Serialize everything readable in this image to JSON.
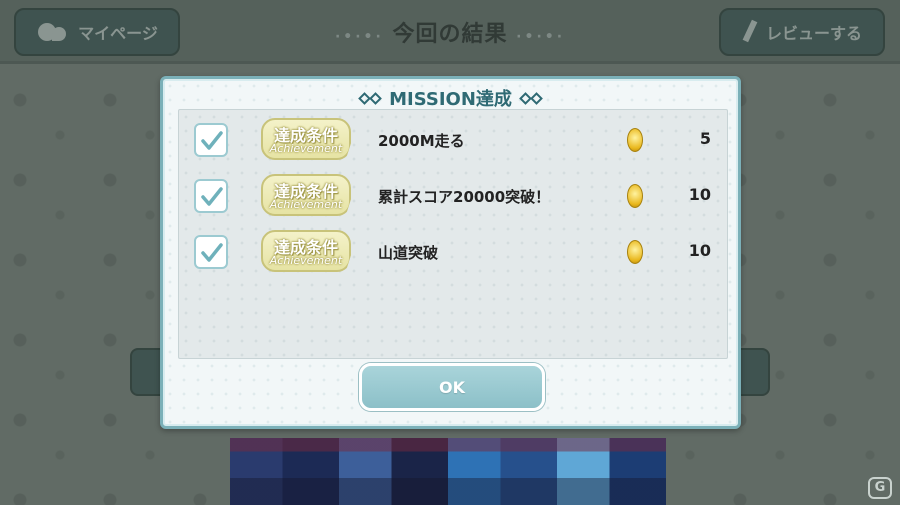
{
  "topbar": {
    "mypage_label": "マイページ",
    "title": "今回の結果",
    "review_label": "レビューする"
  },
  "modal": {
    "title": "MISSION達成",
    "badge_main": "達成条件",
    "badge_sub": "Achievement",
    "missions": [
      {
        "text": "2000M走る",
        "reward": "5",
        "checked": true
      },
      {
        "text": "累計スコア20000突破！",
        "reward": "10",
        "checked": true
      },
      {
        "text": "山道突破",
        "reward": "10",
        "checked": true
      }
    ],
    "ok_label": "OK"
  },
  "watermark": "G",
  "colors": {
    "accent": "#2f6a74",
    "button": "#8cc0c8",
    "badge": "#e6e3a4",
    "coin": "#e9b71c"
  }
}
